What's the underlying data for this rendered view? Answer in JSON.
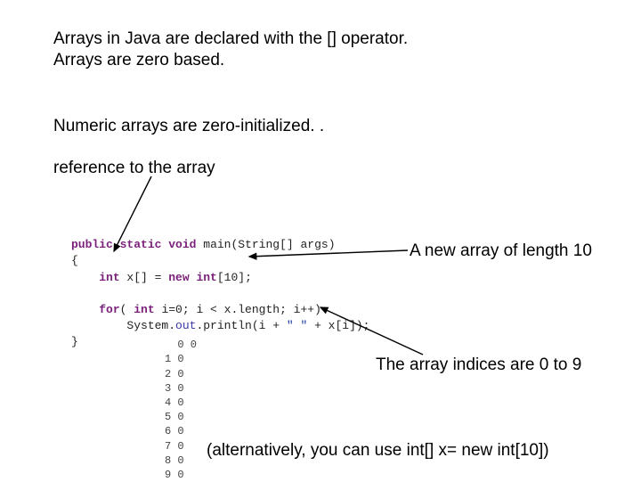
{
  "intro": {
    "line1": "Arrays in Java are declared with the [] operator.",
    "line2": "Arrays are zero based."
  },
  "zeroinit": "Numeric arrays are zero-initialized. .",
  "reftext": "reference to the array",
  "annot_newarray": "A new array of length 10",
  "annot_indices": "The array indices are 0 to 9",
  "alt_text": "(alternatively, you can use int[] x= new int[10])",
  "code": {
    "kw_public": "public",
    "kw_static": "static",
    "kw_void": "void",
    "main_sig": " main(String[] args)",
    "brace_open": "{",
    "indent1": "    ",
    "kw_int1": "int",
    "decl_rest": " x[] = ",
    "kw_new": "new",
    "kw_int2": " int",
    "decl_end": "[10];",
    "for_indent": "    ",
    "kw_for": "for",
    "for_open": "( ",
    "kw_int3": "int",
    "for_cond": " i=0; i < x.length; i++)",
    "println_indent": "        System.",
    "out": "out",
    "println_mid": ".println(i + ",
    "str_space": "\" \"",
    "println_end": " + x[i]);",
    "brace_close": "}"
  },
  "output": "0 0\n1 0\n2 0\n3 0\n4 0\n5 0\n6 0\n7 0\n8 0\n9 0"
}
